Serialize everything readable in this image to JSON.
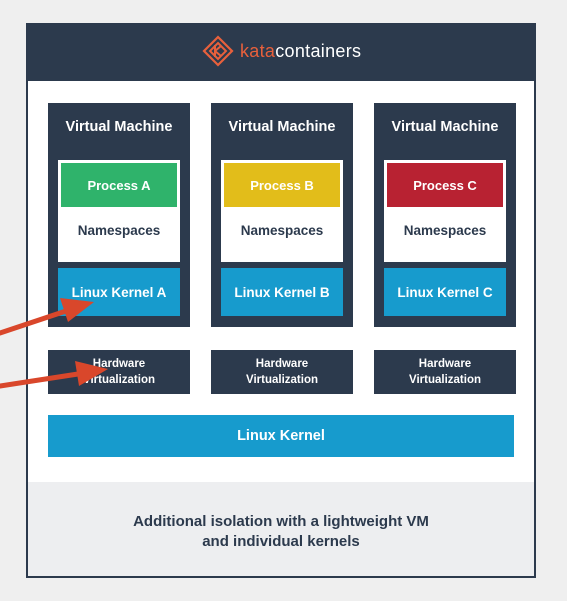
{
  "logo": {
    "text_kata": "kata",
    "text_containers": "containers"
  },
  "vms": [
    {
      "title": "Virtual Machine",
      "process": "Process A",
      "process_color": "#2fb36b",
      "namespaces": "Namespaces",
      "kernel": "Linux Kernel A"
    },
    {
      "title": "Virtual Machine",
      "process": "Process B",
      "process_color": "#e2bd1a",
      "namespaces": "Namespaces",
      "kernel": "Linux Kernel B"
    },
    {
      "title": "Virtual Machine",
      "process": "Process C",
      "process_color": "#b82232",
      "namespaces": "Namespaces",
      "kernel": "Linux Kernel C"
    }
  ],
  "hardware": [
    {
      "line1": "Hardware",
      "line2": "Virtualization"
    },
    {
      "line1": "Hardware",
      "line2": "Virtualization"
    },
    {
      "line1": "Hardware",
      "line2": "Virtualization"
    }
  ],
  "linux_kernel": "Linux Kernel",
  "footer": {
    "line1": "Additional isolation with a lightweight VM",
    "line2": "and individual kernels"
  },
  "colors": {
    "navy": "#2c3a4d",
    "blue": "#179bcd",
    "orange": "#e8603c",
    "arrow": "#d9472b"
  }
}
